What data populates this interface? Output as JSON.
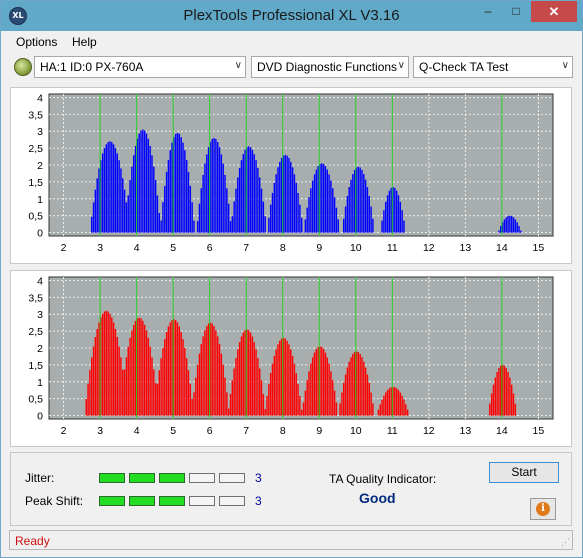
{
  "window": {
    "title": "PlexTools Professional XL V3.16",
    "app_icon_text": "XL",
    "minimize_glyph": "–",
    "maximize_glyph": "□",
    "close_glyph": "✕"
  },
  "menu": {
    "items": [
      "Options",
      "Help"
    ]
  },
  "toolbar": {
    "drive_select": "HA:1 ID:0  PX-760A",
    "function_select": "DVD Diagnostic Functions",
    "test_select": "Q-Check TA Test",
    "dropdown_glyph": "∨"
  },
  "chart_data": [
    {
      "type": "bar",
      "x_ticks": [
        2,
        3,
        4,
        5,
        6,
        7,
        8,
        9,
        10,
        11,
        12,
        13,
        14,
        15
      ],
      "y_ticks": [
        "0",
        "0,5",
        "1",
        "1,5",
        "2",
        "2,5",
        "3",
        "3,5",
        "4"
      ],
      "xlim": [
        1.6,
        15.4
      ],
      "ylim": [
        -0.1,
        4.1
      ],
      "grid": true,
      "series": [
        {
          "color": "#0000ff",
          "peaks": [
            {
              "center": 3.25,
              "half_width": 0.55,
              "height": 2.7
            },
            {
              "center": 4.15,
              "half_width": 0.5,
              "height": 3.05
            },
            {
              "center": 5.1,
              "half_width": 0.48,
              "height": 2.95
            },
            {
              "center": 6.1,
              "half_width": 0.48,
              "height": 2.8
            },
            {
              "center": 7.05,
              "half_width": 0.5,
              "height": 2.55
            },
            {
              "center": 8.05,
              "half_width": 0.5,
              "height": 2.3
            },
            {
              "center": 9.05,
              "half_width": 0.5,
              "height": 2.05
            },
            {
              "center": 10.05,
              "half_width": 0.45,
              "height": 1.95
            },
            {
              "center": 11.0,
              "half_width": 0.35,
              "height": 1.35
            },
            {
              "center": 14.2,
              "half_width": 0.32,
              "height": 0.5
            }
          ]
        }
      ],
      "marker_lines": [
        3,
        4,
        5,
        6,
        7,
        8,
        9,
        10,
        11,
        14
      ],
      "marker_color": "#22cc22"
    },
    {
      "type": "bar",
      "x_ticks": [
        2,
        3,
        4,
        5,
        6,
        7,
        8,
        9,
        10,
        11,
        12,
        13,
        14,
        15
      ],
      "y_ticks": [
        "0",
        "0,5",
        "1",
        "1,5",
        "2",
        "2,5",
        "3",
        "3,5",
        "4"
      ],
      "xlim": [
        1.6,
        15.4
      ],
      "ylim": [
        -0.1,
        4.1
      ],
      "grid": true,
      "series": [
        {
          "color": "#ff0000",
          "peaks": [
            {
              "center": 3.15,
              "half_width": 0.6,
              "height": 3.1
            },
            {
              "center": 4.05,
              "half_width": 0.55,
              "height": 2.9
            },
            {
              "center": 5.0,
              "half_width": 0.55,
              "height": 2.85
            },
            {
              "center": 6.0,
              "half_width": 0.52,
              "height": 2.75
            },
            {
              "center": 7.0,
              "half_width": 0.52,
              "height": 2.55
            },
            {
              "center": 8.0,
              "half_width": 0.52,
              "height": 2.3
            },
            {
              "center": 9.0,
              "half_width": 0.5,
              "height": 2.05
            },
            {
              "center": 10.0,
              "half_width": 0.5,
              "height": 1.9
            },
            {
              "center": 11.0,
              "half_width": 0.45,
              "height": 0.85
            },
            {
              "center": 14.0,
              "half_width": 0.4,
              "height": 1.5
            }
          ]
        }
      ],
      "marker_lines": [
        3,
        4,
        5,
        6,
        7,
        8,
        9,
        10,
        11,
        14
      ],
      "marker_color": "#22cc22"
    }
  ],
  "stats": {
    "jitter_label": "Jitter:",
    "jitter_level": 3,
    "jitter_value": "3",
    "peak_shift_label": "Peak Shift:",
    "peak_shift_level": 3,
    "peak_shift_value": "3",
    "segments_total": 5
  },
  "quality": {
    "label": "TA Quality Indicator:",
    "value": "Good"
  },
  "buttons": {
    "start": "Start",
    "info_glyph": "i"
  },
  "status": {
    "text": "Ready",
    "grip_glyph": "⋰"
  },
  "colors": {
    "plot_bg": "#a8aeae",
    "grid": "#ffffff",
    "good_text": "#002a80",
    "status_text": "#d01010"
  }
}
